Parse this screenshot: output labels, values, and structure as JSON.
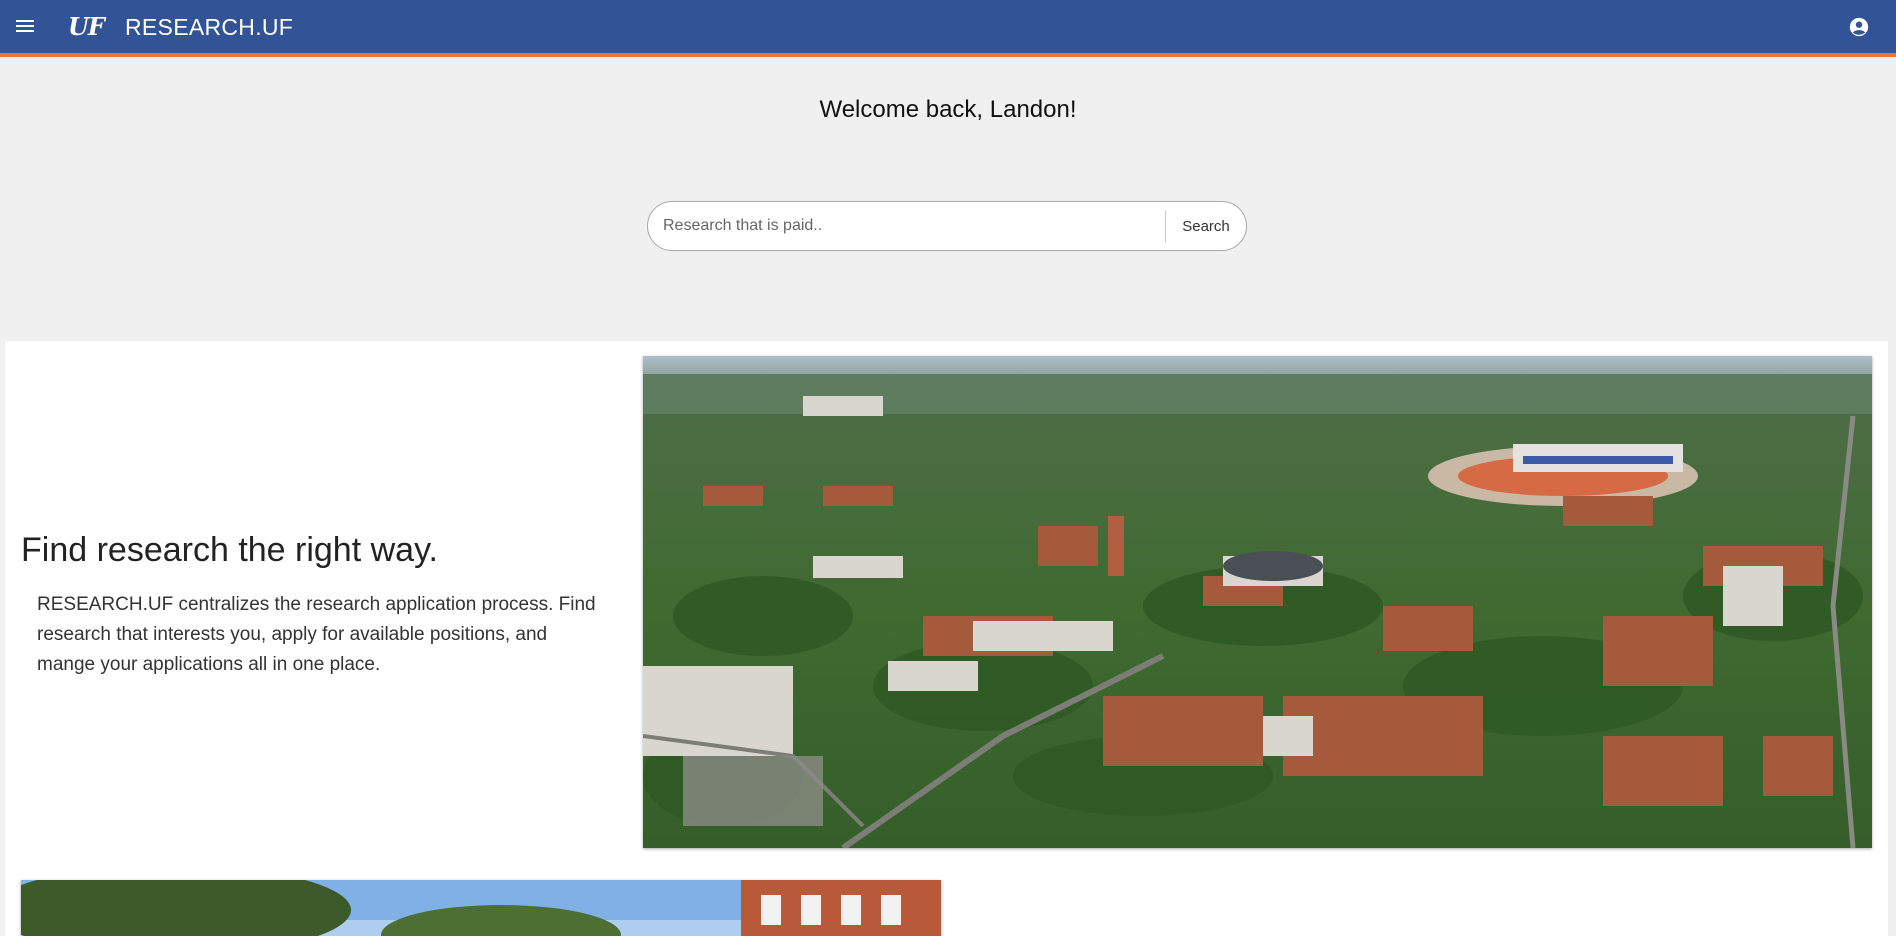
{
  "header": {
    "logo_text": "UF",
    "title": "RESEARCH.UF",
    "menu_icon": "menu-icon",
    "account_icon": "account-circle-icon"
  },
  "welcome": {
    "message": "Welcome back, Landon!"
  },
  "search": {
    "placeholder": "Research that is paid..",
    "value": "",
    "button_label": "Search"
  },
  "hero": {
    "heading": "Find research the right way.",
    "body": "RESEARCH.UF centralizes the research application process. Find research that interests you, apply for available positions, and mange your applications all in one place.",
    "image": "campus-aerial-photo"
  },
  "secondary_image": "campus-building-photo",
  "colors": {
    "header_blue": "#325497",
    "header_accent_orange": "#e8783c",
    "page_background": "#f0f0f0"
  }
}
